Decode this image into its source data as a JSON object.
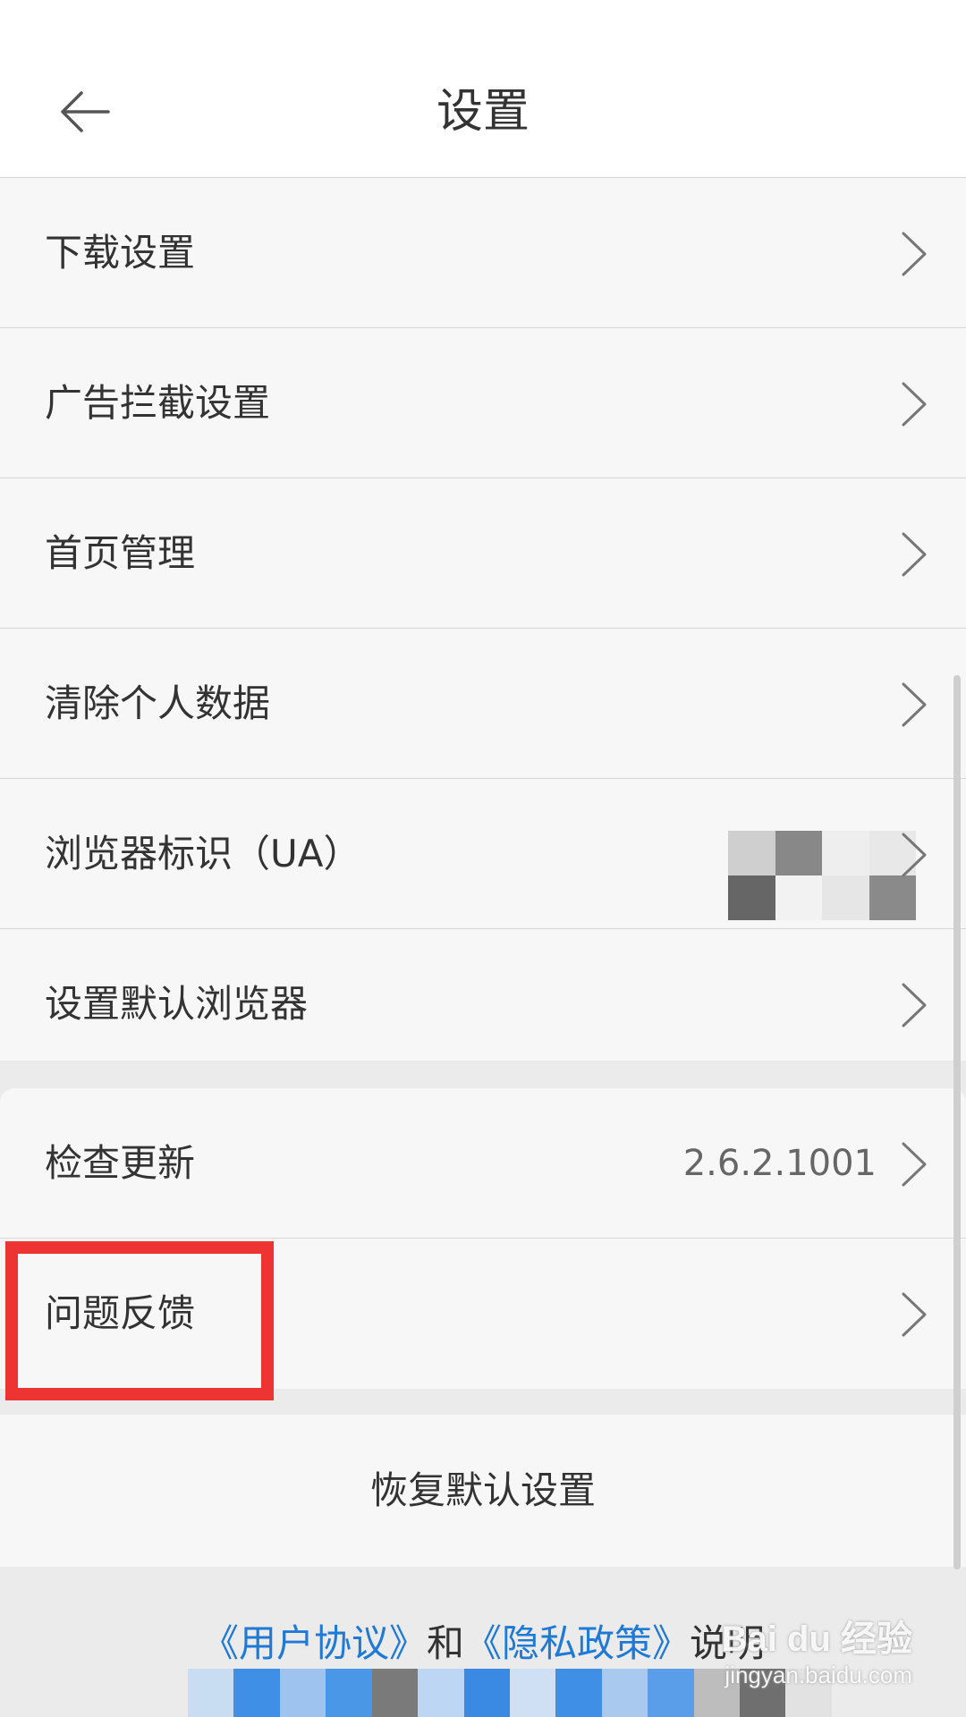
{
  "header": {
    "title": "设置"
  },
  "settings_group_1": [
    {
      "label": "下载设置"
    },
    {
      "label": "广告拦截设置"
    },
    {
      "label": "首页管理"
    },
    {
      "label": "清除个人数据"
    },
    {
      "label": "浏览器标识（UA）"
    },
    {
      "label": "设置默认浏览器"
    }
  ],
  "settings_group_2": [
    {
      "label": "检查更新",
      "value": "2.6.2.1001"
    },
    {
      "label": "问题反馈"
    }
  ],
  "restore_button": "恢复默认设置",
  "footer": {
    "user_agreement": "《用户协议》",
    "and": "和",
    "privacy_policy": "《隐私政策》",
    "explanation": "说明"
  },
  "watermark": {
    "top": "Bai du 经验",
    "bottom": "jingyan.baidu.com"
  },
  "colors": {
    "link": "#1f7ad6",
    "highlight": "#ee3333",
    "background": "#ebebeb",
    "row_background": "#f7f7f7"
  },
  "icons": {
    "back": "arrow-left-icon",
    "chevron": "chevron-right-icon"
  }
}
